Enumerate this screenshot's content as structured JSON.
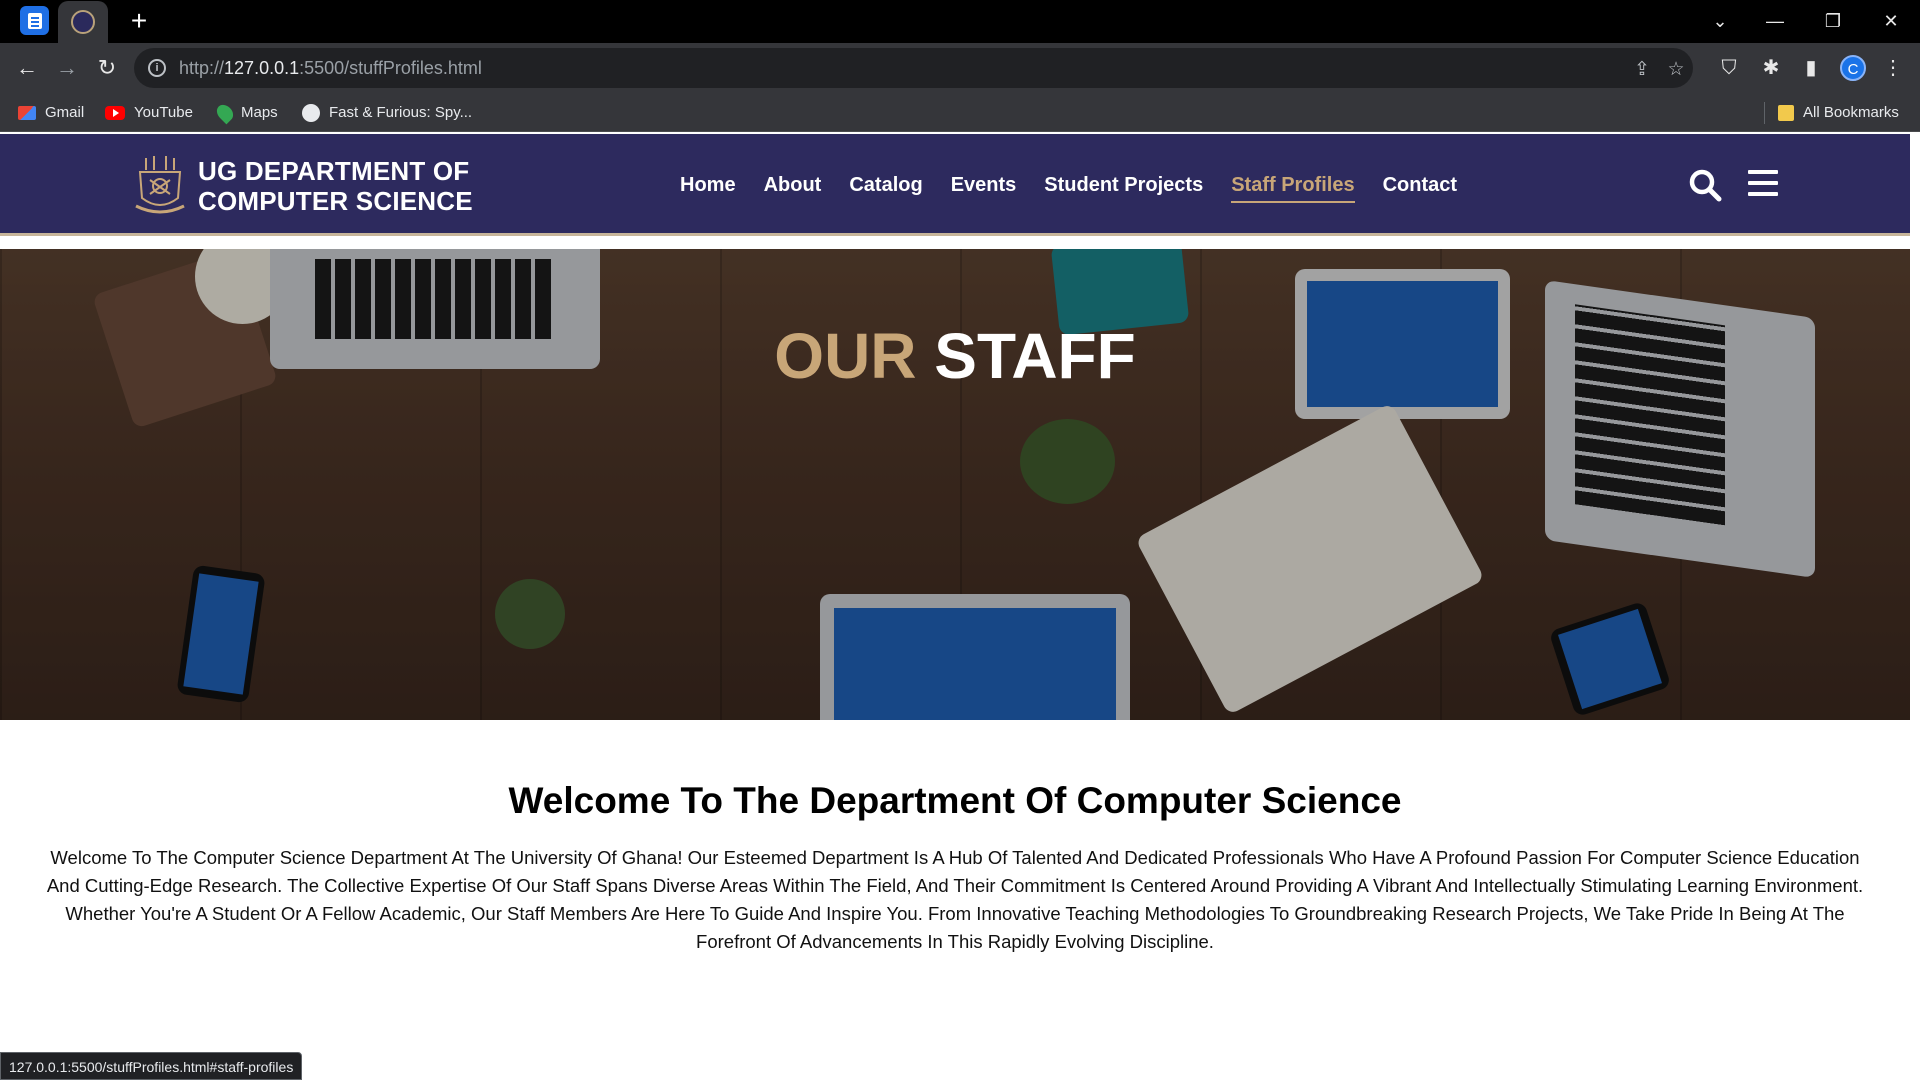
{
  "browser": {
    "url_prefix": "http://",
    "url_host": "127.0.0.1",
    "url_rest": ":5500/stuffProfiles.html",
    "bookmarks": [
      {
        "label": "Gmail",
        "icon": "gmail-icon"
      },
      {
        "label": "YouTube",
        "icon": "youtube-icon"
      },
      {
        "label": "Maps",
        "icon": "maps-icon"
      },
      {
        "label": "Fast & Furious: Spy...",
        "icon": "globe-icon"
      }
    ],
    "all_bookmarks": "All Bookmarks",
    "avatar_letter": "C",
    "status_url": "127.0.0.1:5500/stuffProfiles.html#staff-profiles"
  },
  "site": {
    "brand_line1": "UG DEPARTMENT OF",
    "brand_line2": "COMPUTER SCIENCE",
    "nav": [
      "Home",
      "About",
      "Catalog",
      "Events",
      "Student Projects",
      "Staff Profiles",
      "Contact"
    ],
    "active_nav": "Staff Profiles",
    "colors": {
      "header": "#2d2a5e",
      "accent": "#c8a678"
    }
  },
  "hero": {
    "title_accent": "OUR",
    "title_rest": "STAFF"
  },
  "welcome": {
    "heading": "Welcome To The Department Of Computer Science",
    "para1": "Welcome To The Computer Science Department At The University Of Ghana! Our Esteemed Department Is A Hub Of Talented And Dedicated Professionals Who Have A Profound Passion For Computer Science Education And Cutting-Edge Research. The Collective Expertise Of Our Staff Spans Diverse Areas Within The Field, And Their Commitment Is Centered Around Providing A Vibrant And Intellectually Stimulating Learning Environment.",
    "para2": "Whether You're A Student Or A Fellow Academic, Our Staff Members Are Here To Guide And Inspire You. From Innovative Teaching Methodologies To Groundbreaking Research Projects, We Take Pride In Being At The Forefront Of Advancements In This Rapidly Evolving Discipline."
  }
}
